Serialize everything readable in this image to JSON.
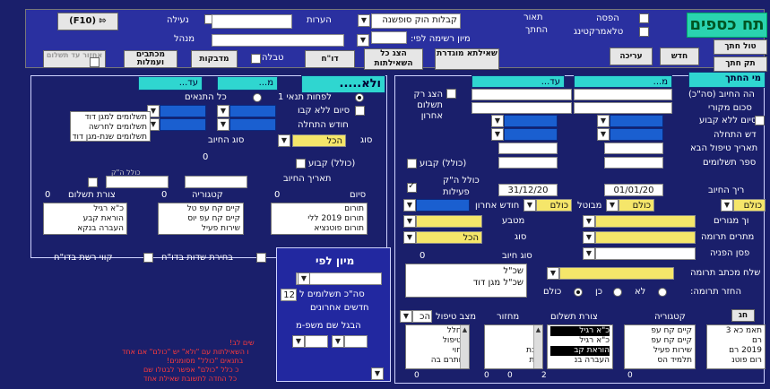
{
  "title": "תח כספים",
  "top": {
    "exit_button": "(F10)",
    "lock_label": "נעילה",
    "notes_label": "הערות",
    "manager_label": "מנהל",
    "description_label": "תאור",
    "description_value": "קבלות הוק סופשנה",
    "sort_list_label": "מיון רשימה לפי:",
    "charges_label": "החתך",
    "printing_label": "הפסה",
    "telemarketing_label": "טלאמרקטינג",
    "btn_dup_column": "אחזור עד תשלום",
    "btn_letters": "מכתבים ועמלות",
    "btn_stickers": "מדבקות",
    "table_label": "טבלה",
    "btn_report": "דו\"ח",
    "btn_show_all": "הצג כל השאילתות",
    "btn_ordered_query": "שאילתא מוגדרת",
    "btn_edit": "עריכה",
    "btn_new": "חדש",
    "btn_cut_section": "טול חתך",
    "btn_copy_section": "תק חתך"
  },
  "left_panel": {
    "header_title": "ולא.....",
    "from_placeholder": "מ...",
    "to_placeholder": "עד...",
    "cond_1": "לפחות תנאי 1",
    "cond_all": "כל התנאים",
    "end_without_label": "סיום ללא קבו",
    "start_month_label": "חודש התחלה",
    "type_label": "סוג",
    "type_value": "הכל",
    "charge_type_label": "סוג החיוב",
    "charge_types": [
      "תשלומים למגן דוד",
      "תשלומים לחרשה",
      "תשלומים שנת-מגן דוד"
    ],
    "fixed_label": "(כולל) קבוע",
    "charge_date_label": "תאריך החיוב",
    "total_hk_label": "כולל ה\"ק",
    "total_hk_sub": "פעילות",
    "payment_form_label": "צורת תשלום",
    "payment_form_count": "0",
    "category_label": "קטגוריה",
    "category_count": "0",
    "end_label": "סיום",
    "end_count": "0",
    "list_payment": [
      "כ\"א רגיל",
      "הוראת קבע",
      "העברה בנקא"
    ],
    "list_category": [
      "קיים קח עפ טל",
      "קיים קח עפ יוס",
      "שירות פעיל"
    ],
    "list_donation": [
      "תורום",
      "תורום 2019 ללי",
      "תורום פוטנציא"
    ],
    "fields_select_label": "בחירת שדות בדו\"ח",
    "report_line_label": "קווי רשת בדו\"ח"
  },
  "right_panel": {
    "from_placeholder": "מ...",
    "to_placeholder": "עד...",
    "header_title": "מי החתך",
    "show_only_last": "הצג רק תשלום אחרון",
    "charge_amount_label": "הה החיוב (סה\"כ)",
    "original_amount_label": "סכום מקורי",
    "end_without_label": "סיום ללא קבוע",
    "start_month_label": "דש התחלה",
    "next_treat_label": "תאריך טיפול הבא",
    "payment_count_label": "ספר תשלומים",
    "fixed_label": "(כולל) קבוע",
    "total_hk_label": "כולל ה\"ק",
    "total_hk_sub": "פעילות",
    "charge_date_label": "ריך החיוב",
    "date_from": "01/01/20",
    "date_to": "31/12/20",
    "last_month_label": "חודש אחרון",
    "cancelled_label": "מבוטל",
    "all_1": "כולם",
    "all_2": "כולם",
    "all_3": "כולם",
    "gender_label": "וך מגורים",
    "currency_label": "מטבע",
    "donors_label": "מתרים תרומה",
    "type_label": "סוג",
    "type_value": "הכל",
    "refer_label": "פסן הפניה",
    "charge_type_label": "סוג חיוב",
    "charge_type_count": "0",
    "donation_letter_label": "שלח מכתב תרומה",
    "donation_return_label": "החזר תרומה:",
    "yes_label": "כן",
    "no_label": "לא",
    "all_label": "כולם",
    "notes_lines": [
      "שכ\"ל",
      "שכ\"ל מגן דוד"
    ],
    "category_label": "קטגוריה",
    "payment_form_label": "צורת תשלום",
    "cycle_label": "מחזור",
    "treat_status_label": "מצב טיפול",
    "treat_status_value": "הכ",
    "list_a": [
      "תאמ כא 3",
      "רם",
      "2019 רם",
      "רום פוטנ"
    ],
    "list_b": [
      "קיים קח עפ",
      "קיים קח עפ",
      "שירות פעיל",
      "תלמיד הס"
    ],
    "list_c": [
      "כ\"א רגיל",
      "כ\"א רגיל",
      "הוראת קב",
      "העברה בנ"
    ],
    "list_d": [
      "ה",
      "ו",
      "גבת",
      "יגת"
    ],
    "list_e": [
      "בחלל",
      "בטיפול",
      "דחוי",
      "הותרם בה"
    ],
    "bottom_counts": [
      "0",
      "0",
      "0",
      "2",
      "0"
    ],
    "sort_button": "חג"
  },
  "mid_panel": {
    "sort_by_title": "מיון לפי",
    "payments_total_label": "סה\"כ תשלומים ל",
    "payments_count": "12",
    "last_months_label": "חדשים אחרונים",
    "family_sort_label": "הבגל שם משפ-מ",
    "red_lines": [
      "שים לב!",
      "ו השאילתות עם \"ולא\" יש \"כולם\" אם אחד",
      "בתנאים \"כולל\" מסומנים!",
      "כ כלל \"כולם\" אפשר לבטלו שם",
      "כל החדה לתשובת שאילת אחד"
    ]
  }
}
